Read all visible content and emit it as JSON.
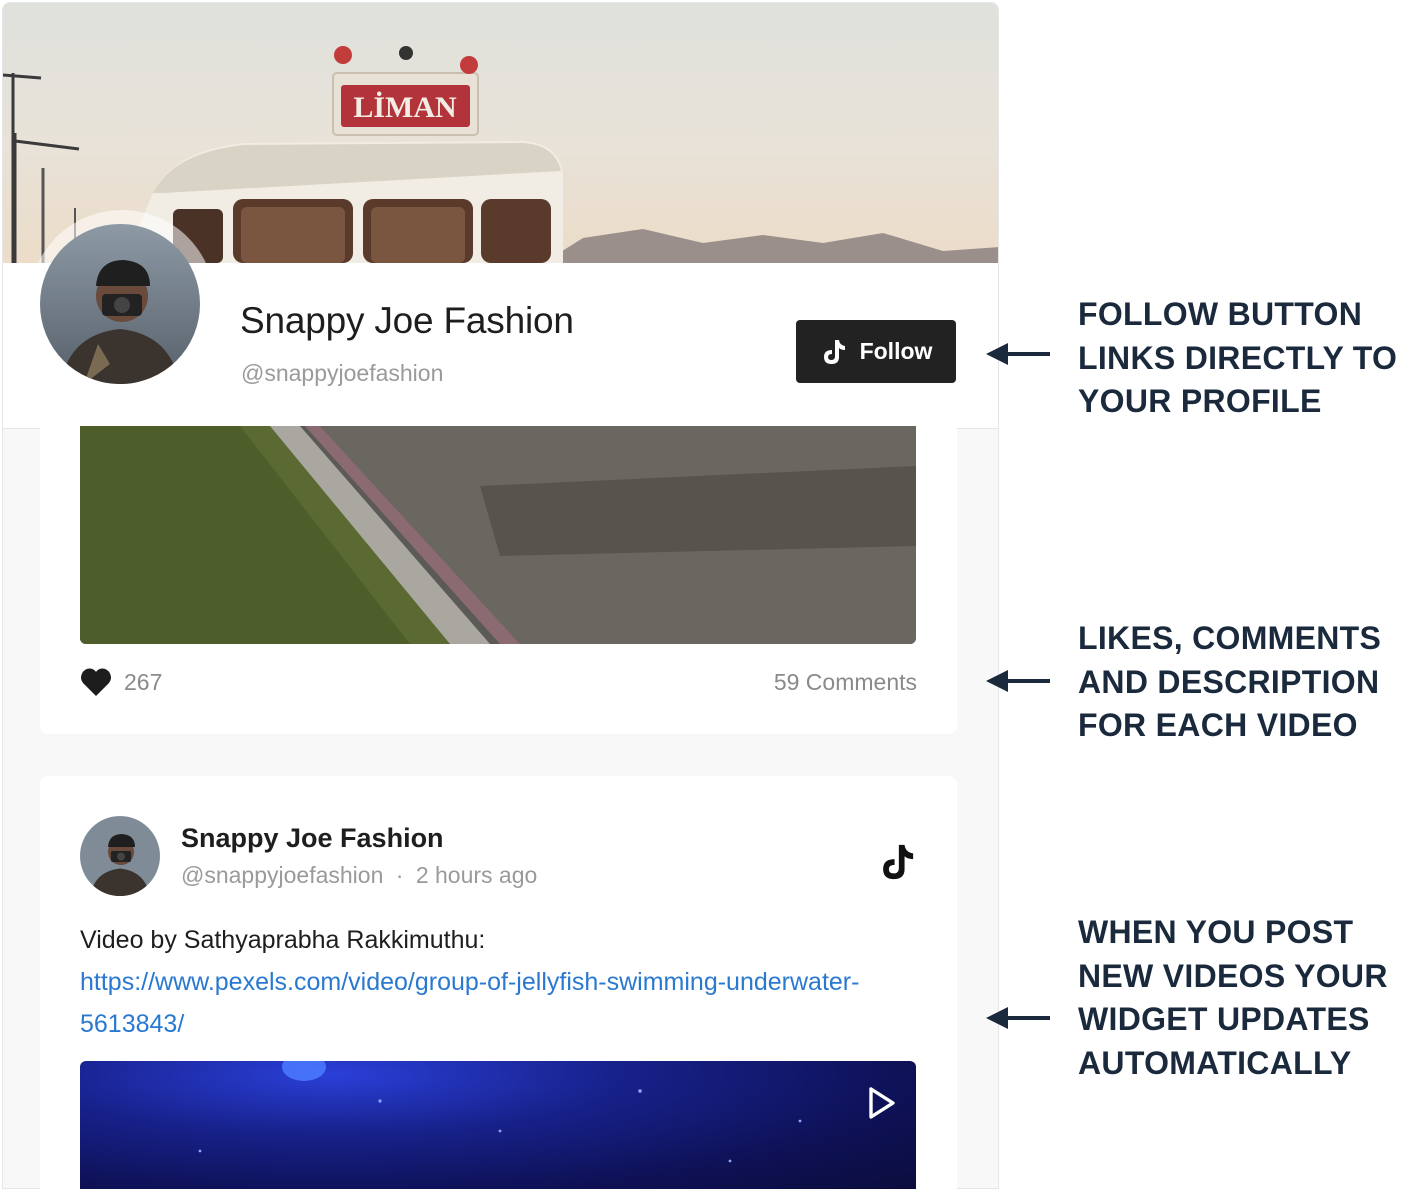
{
  "profile": {
    "name": "Snappy Joe Fashion",
    "handle": "@snappyjoefashion",
    "follow_label": "Follow",
    "cover_sign": "LİMAN"
  },
  "posts": [
    {
      "likes": "267",
      "comments": "59 Comments"
    },
    {
      "author": "Snappy Joe Fashion",
      "handle": "@snappyjoefashion",
      "separator": "·",
      "time": "2 hours ago",
      "text": "Video by Sathyaprabha Rakkimuthu:",
      "link": "https://www.pexels.com/video/group-of-jellyfish-swimming-underwater-5613843/"
    }
  ],
  "annotations": [
    "FOLLOW BUTTON LINKS DIRECTLY TO YOUR PROFILE",
    "LIKES, COMMENTS AND DESCRIPTION FOR EACH VIDEO",
    "WHEN YOU POST NEW VIDEOS YOUR WIDGET UPDATES AUTOMATICALLY"
  ],
  "colors": {
    "follow_button": "#222222",
    "link": "#2a79d0",
    "annotation_text": "#1a2a3c"
  },
  "icons": [
    "tiktok-icon",
    "heart-icon",
    "play-icon",
    "arrow-left-icon"
  ]
}
